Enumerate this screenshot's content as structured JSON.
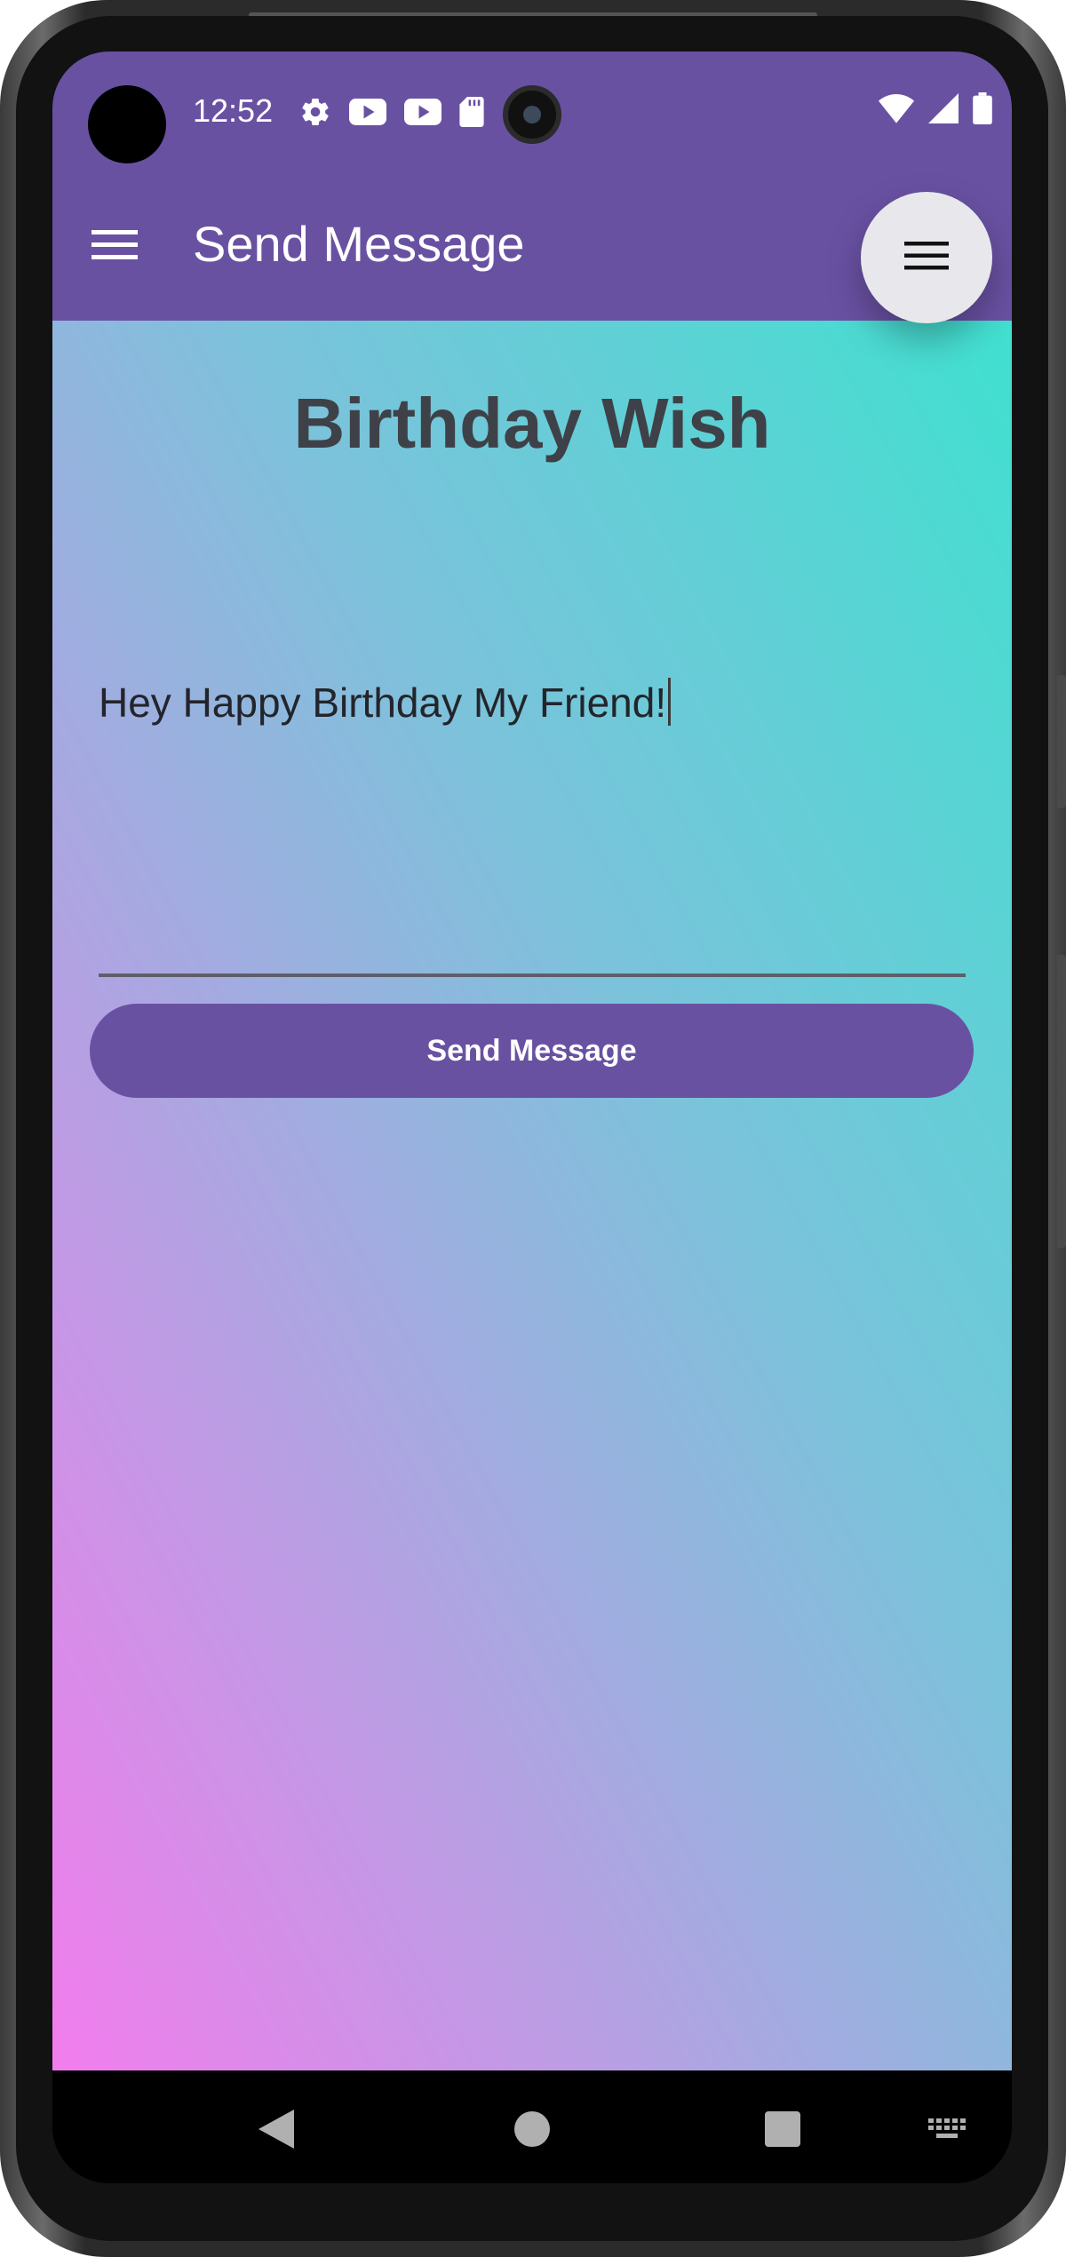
{
  "status_bar": {
    "time": "12:52",
    "icons_left": [
      "settings-icon",
      "youtube-icon",
      "youtube-icon",
      "sd-card-icon"
    ],
    "icons_right": [
      "wifi-icon",
      "signal-icon",
      "battery-icon"
    ]
  },
  "app_bar": {
    "title": "Send Message",
    "menu_icon": "menu-icon",
    "background": "#6951a2"
  },
  "fab": {
    "icon": "menu-icon"
  },
  "main": {
    "heading": "Birthday Wish",
    "message_value": "Hey Happy Birthday My Friend!",
    "send_button_label": "Send Message",
    "button_color": "#6951a2"
  },
  "nav_bar": {
    "items": [
      "back-icon",
      "home-icon",
      "recents-icon",
      "keyboard-icon"
    ]
  },
  "colors": {
    "gradient_bottom_left": "#f27ded",
    "gradient_top_right": "#40e0d0",
    "heading_text": "#3f4148"
  }
}
